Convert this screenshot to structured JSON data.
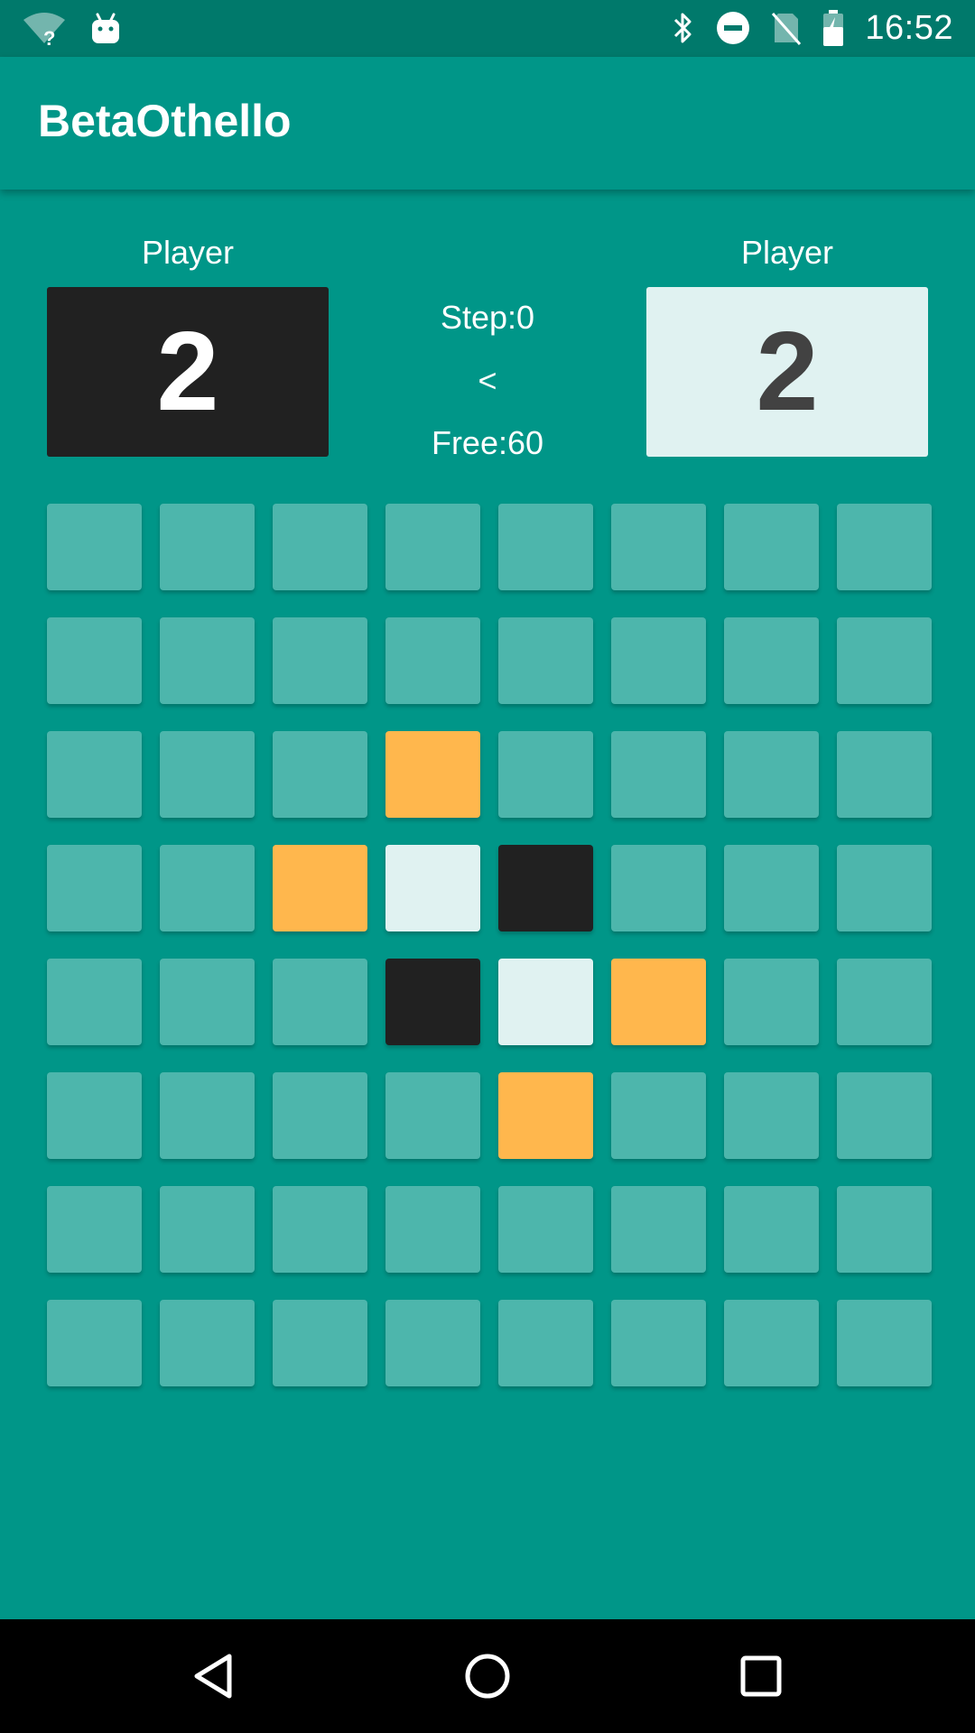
{
  "status_bar": {
    "time": "16:52",
    "left_icons": [
      "wifi-unknown-icon",
      "android-icon"
    ],
    "right_icons": [
      "bluetooth-icon",
      "do-not-disturb-icon",
      "no-sim-icon",
      "battery-charging-icon"
    ]
  },
  "app_bar": {
    "title": "BetaOthello"
  },
  "scoreboard": {
    "black_player": {
      "label": "Player",
      "score": "2"
    },
    "white_player": {
      "label": "Player",
      "score": "2"
    },
    "step": "Step:0",
    "turn_indicator": "<",
    "free": "Free:60"
  },
  "board": {
    "size": 8,
    "colors": {
      "empty": "#4db6ac",
      "black": "#212121",
      "white": "#e0f2f1",
      "hint": "#ffb74d",
      "background": "#009688"
    },
    "cells": [
      [
        "empty",
        "empty",
        "empty",
        "empty",
        "empty",
        "empty",
        "empty",
        "empty"
      ],
      [
        "empty",
        "empty",
        "empty",
        "empty",
        "empty",
        "empty",
        "empty",
        "empty"
      ],
      [
        "empty",
        "empty",
        "empty",
        "hint",
        "empty",
        "empty",
        "empty",
        "empty"
      ],
      [
        "empty",
        "empty",
        "hint",
        "white",
        "black",
        "empty",
        "empty",
        "empty"
      ],
      [
        "empty",
        "empty",
        "empty",
        "black",
        "white",
        "hint",
        "empty",
        "empty"
      ],
      [
        "empty",
        "empty",
        "empty",
        "empty",
        "hint",
        "empty",
        "empty",
        "empty"
      ],
      [
        "empty",
        "empty",
        "empty",
        "empty",
        "empty",
        "empty",
        "empty",
        "empty"
      ],
      [
        "empty",
        "empty",
        "empty",
        "empty",
        "empty",
        "empty",
        "empty",
        "empty"
      ]
    ]
  },
  "nav_bar": {
    "buttons": [
      "back-icon",
      "home-icon",
      "recents-icon"
    ]
  }
}
